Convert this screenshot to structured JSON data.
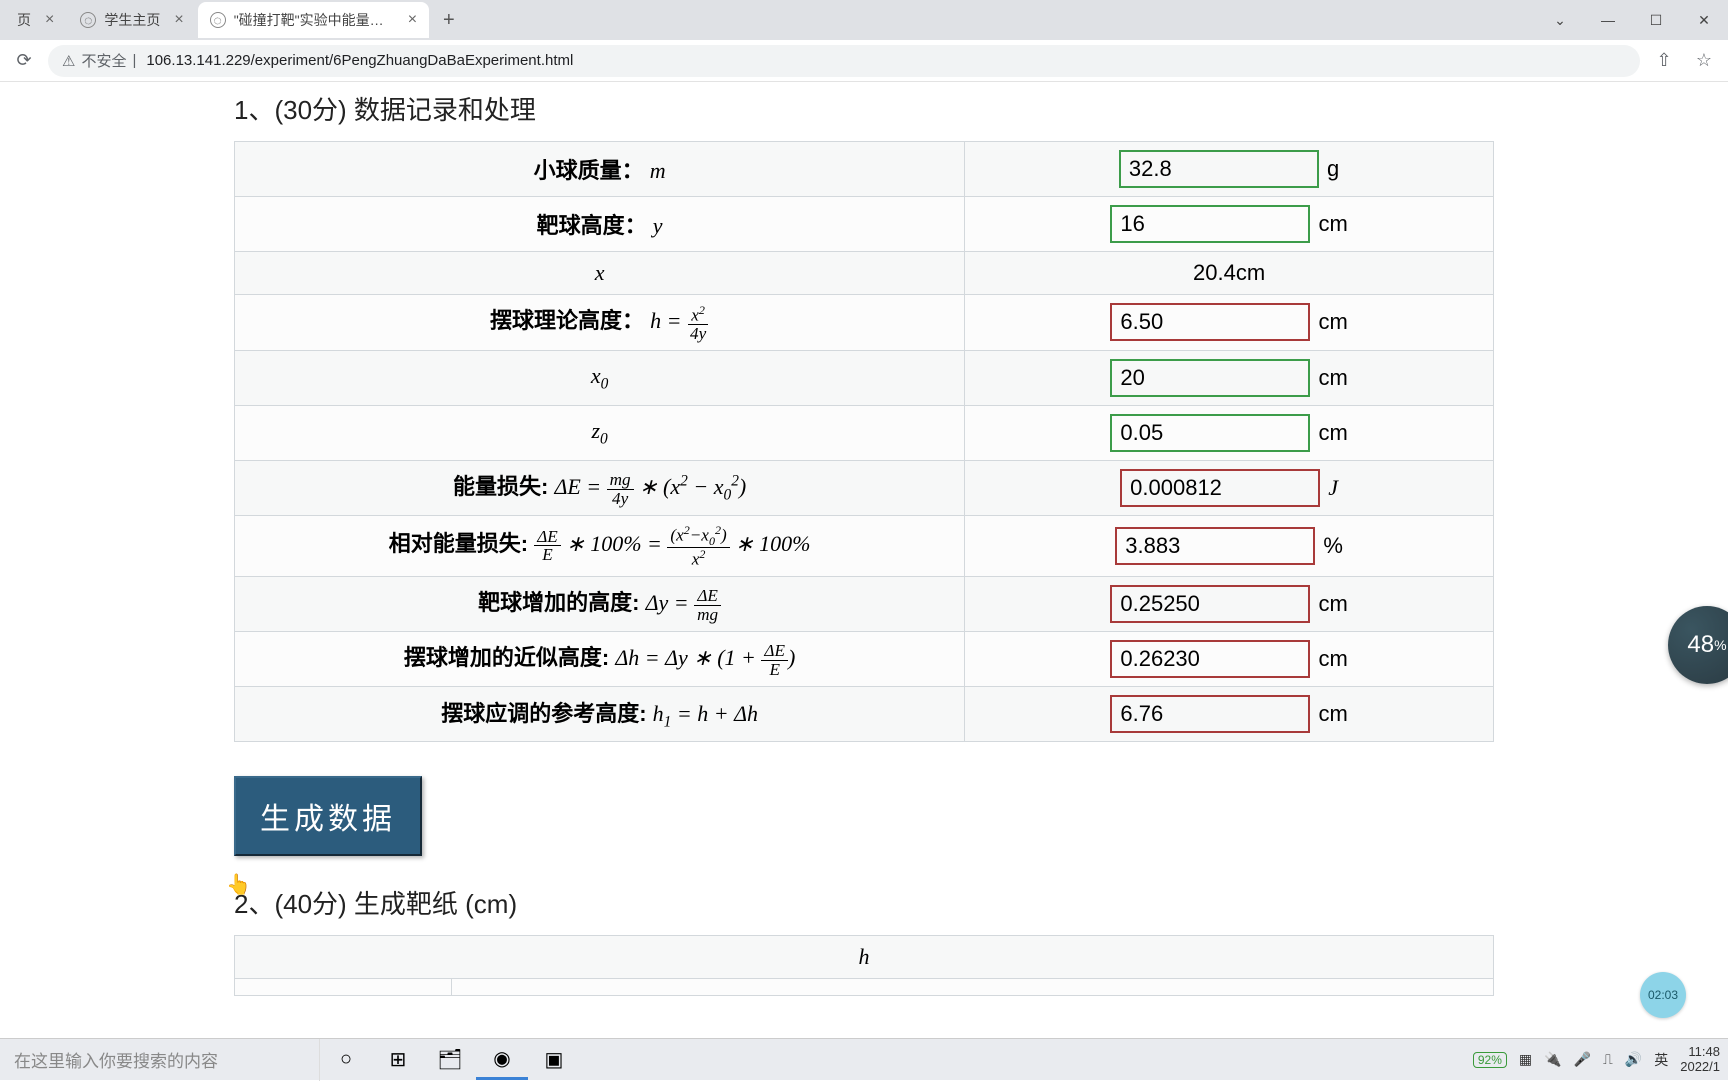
{
  "browser": {
    "tabs": [
      {
        "title": "页",
        "active": false
      },
      {
        "title": "学生主页",
        "active": false
      },
      {
        "title": "\"碰撞打靶\"实验中能量损失的分析",
        "active": true
      }
    ],
    "newTab": "+",
    "security_label": "不安全",
    "url": "106.13.141.229/experiment/6PengZhuangDaBaExperiment.html",
    "window": {
      "minimize": "—",
      "maximize": "☐",
      "close": "✕",
      "chevron": "⌄"
    }
  },
  "section1": {
    "title": "1、(30分) 数据记录和处理",
    "rows": {
      "mass": {
        "label": "小球质量：",
        "sym": "m",
        "value": "32.8",
        "unit": "g",
        "style": "green"
      },
      "targetH": {
        "label": "靶球高度：",
        "sym": "y",
        "value": "16",
        "unit": "cm",
        "style": "green"
      },
      "x": {
        "sym": "x",
        "plain": "20.4cm"
      },
      "h_theory": {
        "label": "摆球理论高度：",
        "value": "6.50",
        "unit": "cm",
        "style": "red"
      },
      "x0": {
        "sym": "x₀",
        "value": "20",
        "unit": "cm",
        "style": "green"
      },
      "z0": {
        "sym": "z₀",
        "value": "0.05",
        "unit": "cm",
        "style": "green"
      },
      "dE": {
        "label": "能量损失:",
        "value": "0.000812",
        "unit": "J",
        "style": "red"
      },
      "dE_rel": {
        "label": "相对能量损失:",
        "value": "3.883",
        "unit": "%",
        "style": "red"
      },
      "dy": {
        "label": "靶球增加的高度:",
        "value": "0.25250",
        "unit": "cm",
        "style": "red"
      },
      "dh": {
        "label": "摆球增加的近似高度:",
        "value": "0.26230",
        "unit": "cm",
        "style": "red"
      },
      "h1": {
        "label": "摆球应调的参考高度:",
        "value": "6.76",
        "unit": "cm",
        "style": "red"
      }
    }
  },
  "generate_button": "生成数据",
  "section2": {
    "title": "2、(40分) 生成靶纸 (cm)",
    "col_header": "h"
  },
  "taskbar": {
    "search_placeholder": "在这里输入你要搜索的内容",
    "battery": "92%",
    "ime": "英",
    "time": "11:48",
    "date": "2022/1"
  },
  "floats": {
    "big_value": "48",
    "big_pct": "%",
    "small_clock": "02:03"
  }
}
